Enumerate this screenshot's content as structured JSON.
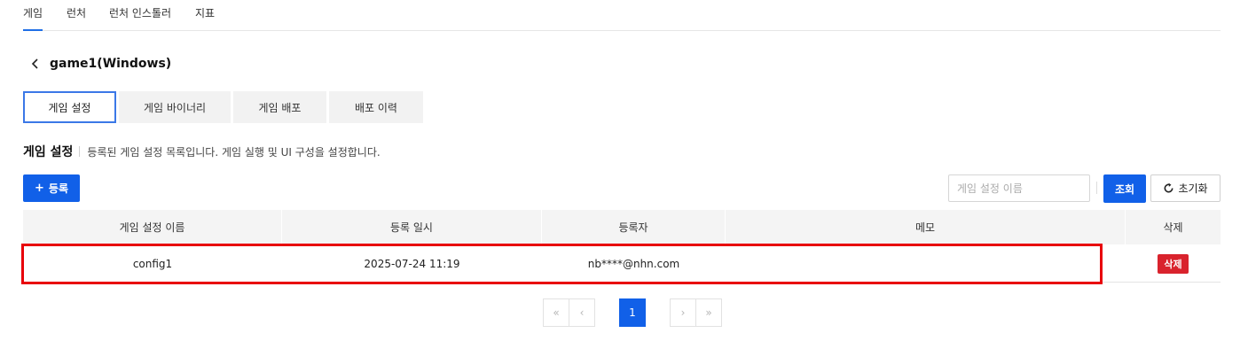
{
  "top_nav": {
    "items": [
      {
        "label": "게임",
        "active": true
      },
      {
        "label": "런처",
        "active": false
      },
      {
        "label": "런처 인스톨러",
        "active": false
      },
      {
        "label": "지표",
        "active": false
      }
    ]
  },
  "header": {
    "back_icon": "chevron-left-icon",
    "title": "game1(Windows)"
  },
  "tabs": [
    {
      "label": "게임 설정",
      "active": true
    },
    {
      "label": "게임 바이너리",
      "active": false
    },
    {
      "label": "게임 배포",
      "active": false
    },
    {
      "label": "배포 이력",
      "active": false
    }
  ],
  "section": {
    "title": "게임 설정",
    "description": "등록된 게임 설정 목록입니다. 게임 실행 및 UI 구성을 설정합니다."
  },
  "toolbar": {
    "add_plus": "+",
    "add_label": "등록",
    "search_placeholder": "게임 설정 이름",
    "search_value": "",
    "search_label": "조회",
    "reset_icon": "refresh-icon",
    "reset_label": "초기화"
  },
  "table": {
    "columns": [
      "게임 설정 이름",
      "등록 일시",
      "등록자",
      "메모",
      "삭제"
    ],
    "rows": [
      {
        "name": "config1",
        "registered_at": "2025-07-24 11:19",
        "registrant": "nb****@nhn.com",
        "memo": "",
        "delete_label": "삭제"
      }
    ]
  },
  "pagination": {
    "first": "«",
    "prev": "‹",
    "pages": [
      "1"
    ],
    "current": "1",
    "next": "›",
    "last": "»"
  },
  "colors": {
    "primary": "#1160e8",
    "danger": "#d9232d",
    "highlight": "#e8000b",
    "header_bg": "#f4f4f4"
  }
}
